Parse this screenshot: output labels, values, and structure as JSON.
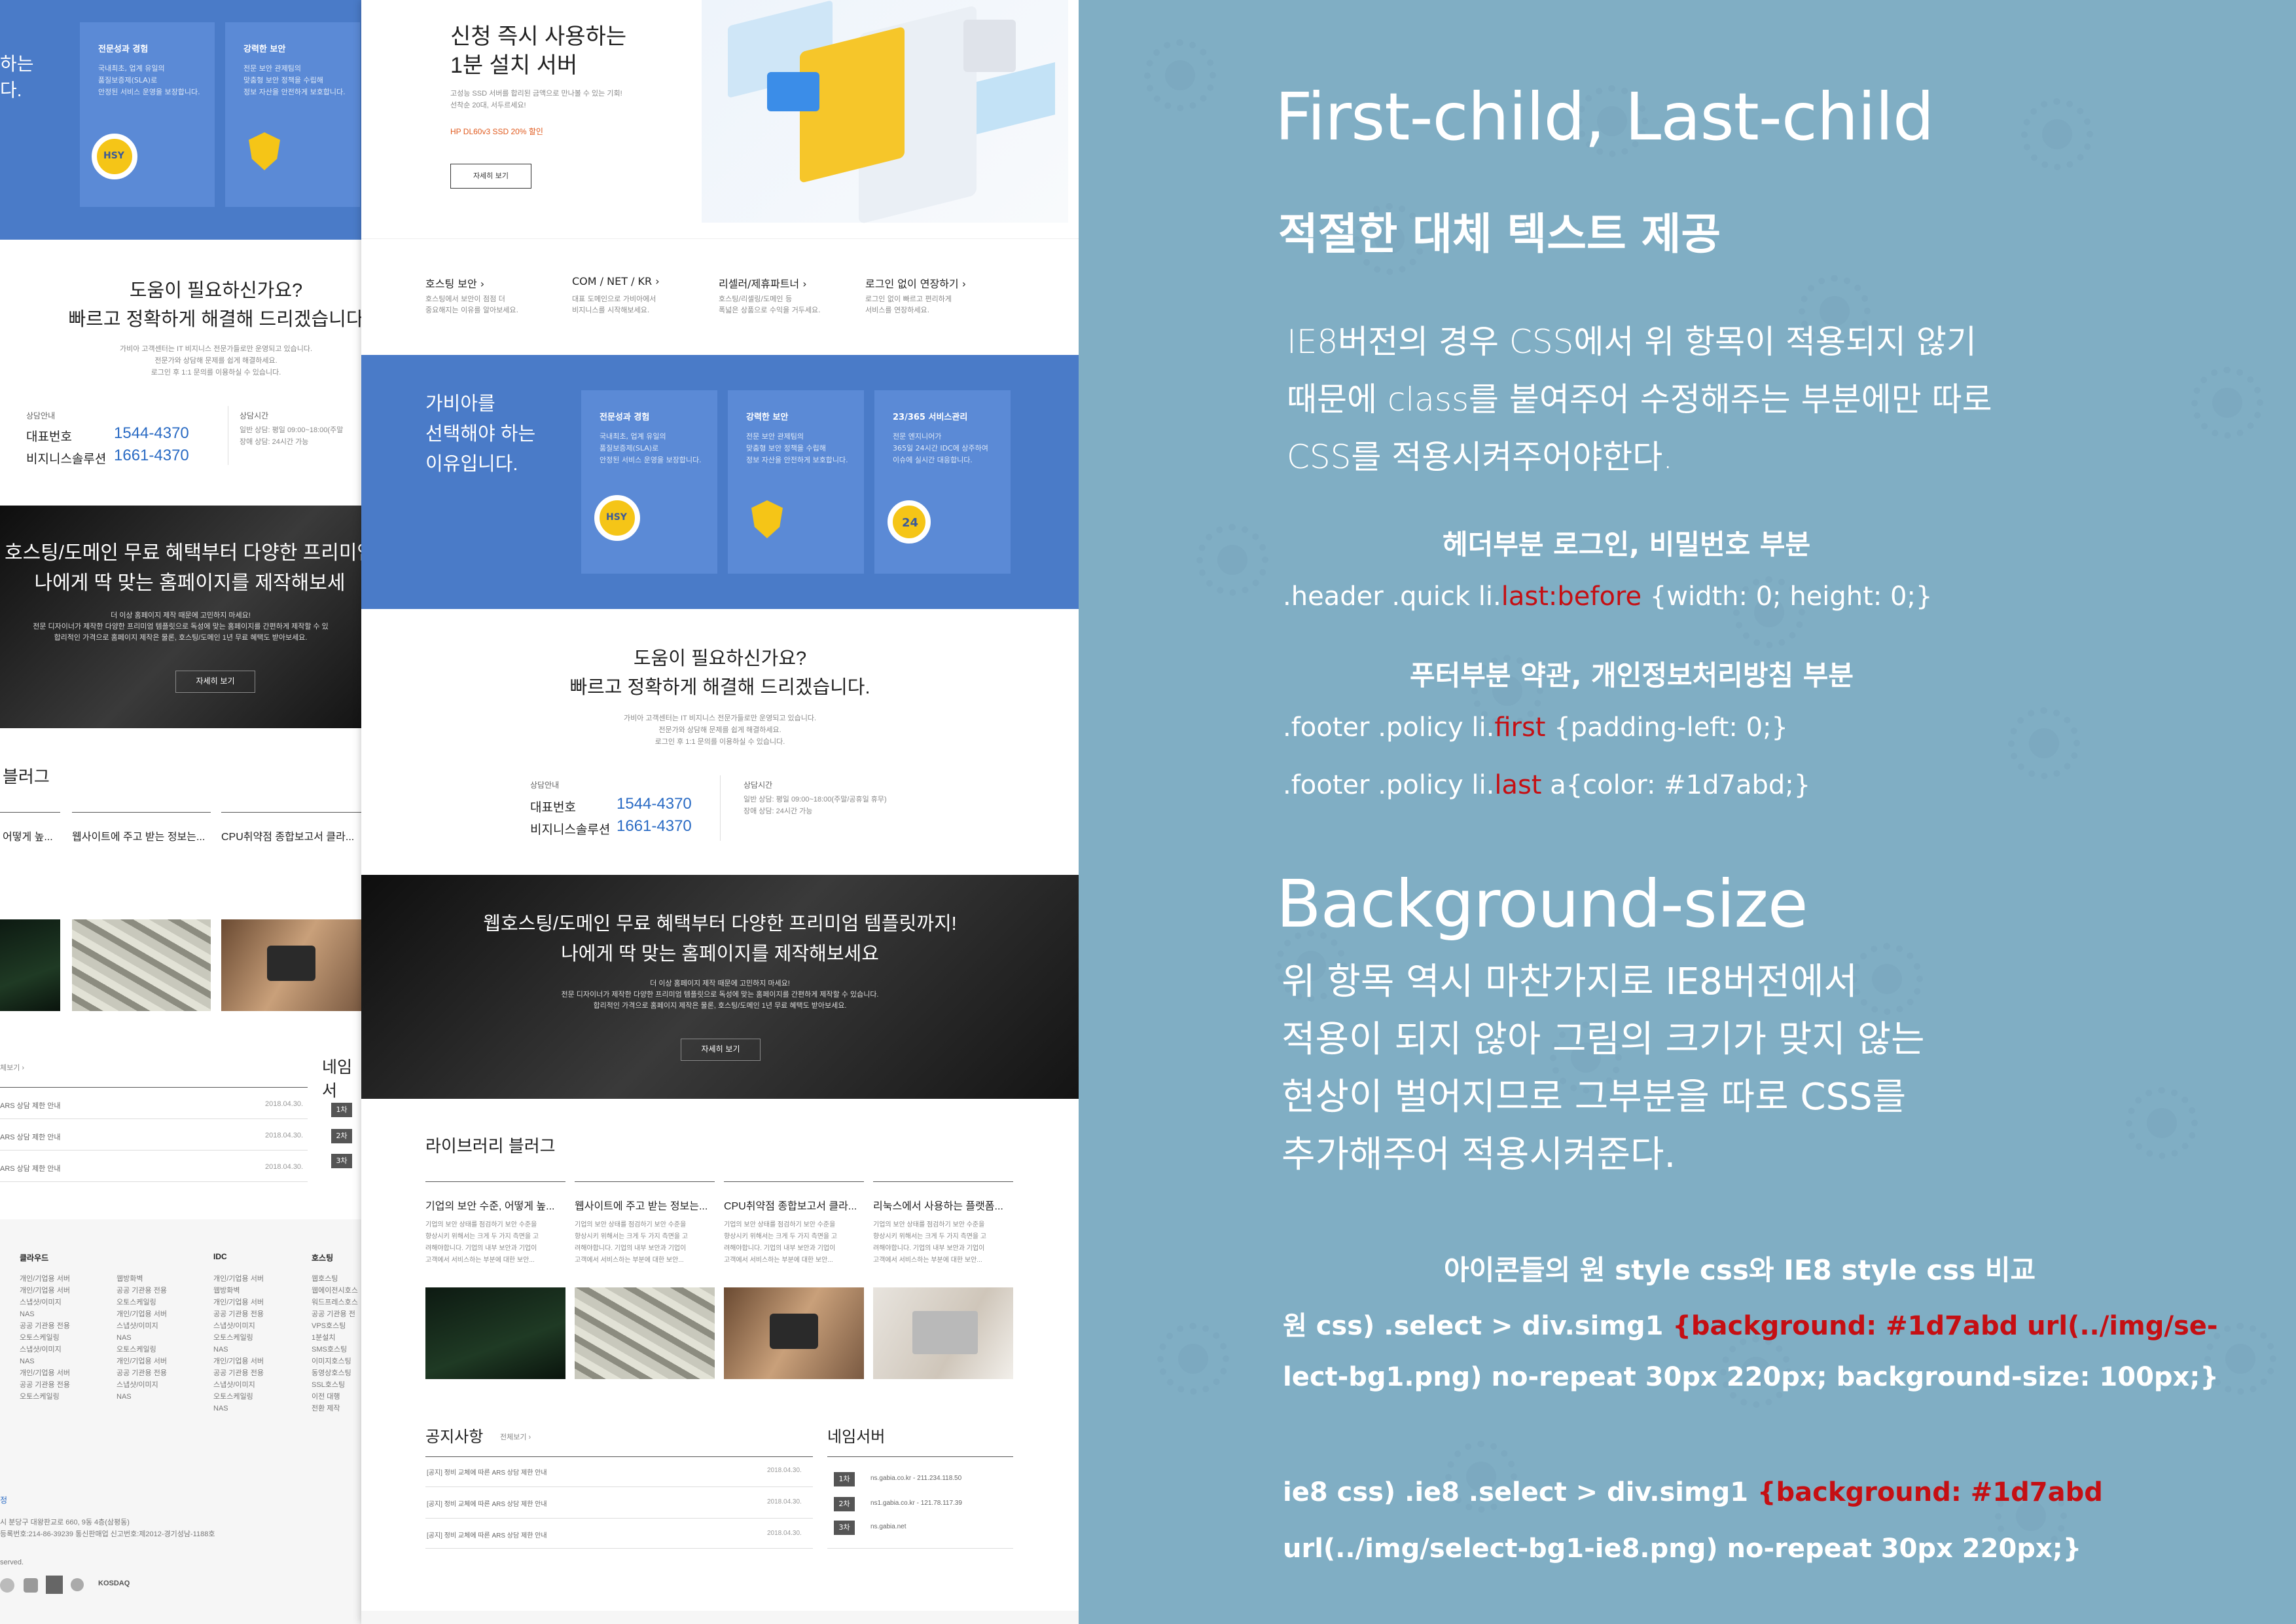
{
  "notes": {
    "h1": "First-child, Last-child",
    "h2": "적절한 대체 텍스트 제공",
    "para1": "IE8버전의 경우 CSS에서 위 항목이 적용되지 않기\n때문에 class를 붙여주어 수정해주는 부분에만 따로\nCSS를 적용시켜주어야한다.",
    "sub1": "헤더부분 로그인, 비밀번호 부분",
    "code1a": ".header .quick li.",
    "code1b": "last:before",
    "code1c": " {width: 0; height: 0;}",
    "sub2": "푸터부분 약관, 개인정보처리방침 부분",
    "code2a": ".footer .policy li.",
    "code2b": "first",
    "code2c": " {padding-left: 0;}",
    "code3a": ".footer .policy li.",
    "code3b": "last",
    "code3c": " a{color: #1d7abd;}",
    "h1b": "Background-size",
    "para2": "위 항목 역시 마찬가지로 IE8버전에서\n적용이 되지 않아 그림의 크기가 맞지 않는\n현상이 벌어지므로 그부분을 따로 CSS를\n추가해주어 적용시켜준다.",
    "sub3": "아이콘들의 원 style css와 IE8 style css 비교",
    "orig_label": "원 css) .select > div.simg1 ",
    "orig_red1": "{background: #1d7abd url(../img/se-",
    "orig_red2": "lect-bg1.png) no-repeat 30px 220px; background-size: 100px;}",
    "ie8_label": "ie8 css) .ie8 .select > div.simg1 ",
    "ie8_red1": "{background: #1d7abd",
    "ie8_red2": "url(../img/select-bg1-ie8.png) no-repeat 30px 220px;}"
  },
  "page": {
    "hero_title": "신청 즉시 사용하는\n1분 설치 서버",
    "hero_desc": "고성능 SSD 서버를 합리된 금액으로 만나볼 수 있는 기회!\n선착순 20대, 서두르세요!",
    "hero_promo": "HP DL60v3 SSD 20% 할인",
    "hero_btn": "자세히 보기",
    "nav": [
      {
        "title": "호스팅 보안 ›",
        "desc": "호스팅에서 보안이 점점 더\n중요해지는 이유를 알아보세요."
      },
      {
        "title": "COM / NET / KR ›",
        "desc": "대표 도메인으로 가비아에서\n비지니스를 시작해보세요."
      },
      {
        "title": "리셀러/제휴파트너 ›",
        "desc": "호스팅/리셀링/도메인 등\n폭넓은 상품으로 수익을 거두세요."
      },
      {
        "title": "로그인 없이 연장하기 ›",
        "desc": "로그인 없이 빠르고 편리하게\n서비스를 연장하세요."
      }
    ],
    "why_title": "가비아를\n선택해야 하는\n이유입니다.",
    "cards": [
      {
        "title": "전문성과 경험",
        "desc": "국내최초, 업계 유일의\n품질보증제(SLA)로\n안정된 서비스 운영을 보장합니다."
      },
      {
        "title": "강력한 보안",
        "desc": "전문 보안 관제팀의\n맞춤형 보안 정책을 수립해\n정보 자산을 안전하게 보호합니다."
      },
      {
        "title": "23/365 서비스관리",
        "desc": "전문 엔지니어가\n365일 24시간 IDC에 상주하여\n이슈에 실시간 대응합니다."
      }
    ],
    "help_title": "도움이 필요하신가요?\n빠르고 정확하게 해결해 드리겠습니다.",
    "help_desc": "가비아 고객센터는 IT 비지니스 전문가들로만 운영되고 있습니다.\n전문가와 상담해 문제를 쉽게 해결하세요.\n로그인 후 1:1 문의를 이용하실 수 있습니다.",
    "consult_label": "상담안내",
    "rep_label": "대표번호",
    "rep_phone": "1544-4370",
    "biz_label": "비지니스솔루션",
    "biz_phone": "1661-4370",
    "hours_label": "상담시간",
    "hours_desc": "일반 상담: 평일 09:00~18:00(주말/공휴일 휴무)\n장애 상담: 24시간 가능",
    "promo_title": "웹호스팅/도메인 무료 혜택부터 다양한 프리미엄 템플릿까지!\n나에게 딱 맞는 홈페이지를 제작해보세요",
    "promo_desc": "더 이상 홈페이지 제작 때문에 고민하지 마세요!\n전문 디자이너가 제작한 다양한 프리미엄 템플릿으로 독성에 맞는 홈페이지를 간편하게 제작할 수 있습니다.\n합리적인 가격으로 홈페이지 제작은 물론, 호스팅/도메인 1년 무료 혜택도 받아보세요.",
    "promo_btn": "자세히 보기",
    "blog_title": "라이브러리 블러그",
    "posts": [
      {
        "title": "기업의 보안 수준, 어떻게 높...",
        "desc": "기업의 보안 상태를 점검하기 보안 수준을\n향상시키 위해서는 크게 두 가지 측면을 고\n려해야합니다. 기업의 내부 보안과 기업이\n고객에서 서비스하는 부분에 대한 보안..."
      },
      {
        "title": "웹사이트에 주고 받는 정보는...",
        "desc": "기업의 보안 상태를 점검하기 보안 수준을\n향상시키 위해서는 크게 두 가지 측면을 고\n려해야합니다. 기업의 내부 보안과 기업이\n고객에서 서비스하는 부분에 대한 보안..."
      },
      {
        "title": "CPU취약점 종합보고서 클라...",
        "desc": "기업의 보안 상태를 점검하기 보안 수준을\n향상시키 위해서는 크게 두 가지 측면을 고\n려해야합니다. 기업의 내부 보안과 기업이\n고객에서 서비스하는 부분에 대한 보안..."
      },
      {
        "title": "리눅스에서 사용하는 플랫폼...",
        "desc": "기업의 보안 상태를 점검하기 보안 수준을\n향상시키 위해서는 크게 두 가지 측면을 고\n려해야합니다. 기업의 내부 보안과 기업이\n고객에서 서비스하는 부분에 대한 보안..."
      }
    ],
    "notice_title": "공지사항",
    "notice_more": "전체보기 ›",
    "notices": [
      {
        "text": "[공지] 정비 교체에 따른 ARS 상담 제한 안내",
        "date": "2018.04.30."
      },
      {
        "text": "[공지] 정비 교체에 따른 ARS 상담 제한 안내",
        "date": "2018.04.30."
      },
      {
        "text": "[공지] 정비 교체에 따른 ARS 상담 제한 안내",
        "date": "2018.04.30."
      }
    ],
    "ns_title": "네임서버",
    "ns": [
      {
        "rank": "1차",
        "text": "ns.gabia.co.kr - 211.234.118.50"
      },
      {
        "rank": "2차",
        "text": "ns1.gabia.co.kr - 121.78.117.39"
      },
      {
        "rank": "3차",
        "text": "ns.gabia.net"
      }
    ]
  },
  "left": {
    "hero_tail": "하는\n다.",
    "card1_title": "전문성과 경험",
    "card1_desc": "국내최초, 업계 유일의\n품질보증제(SLA)로\n안정된 서비스 운영을 보장합니다.",
    "card2_title": "강력한 보안",
    "card2_desc": "전문 보안 관제팀의\n맞춤형 보안 정책을 수립해\n정보 자산을 안전하게 보호합니다.",
    "help_title": "도움이 필요하신가요?\n빠르고 정확하게 해결해 드리겠습니다",
    "help_desc": "가비아 고객센터는 IT 비지니스 전문가들로만 운영되고 있습니다.\n전문가와 상담해 문제를 쉽게 해결하세요.\n로그인 후 1:1 문의를 이용하실 수 있습니다.",
    "consult_label": "상담안내",
    "rep_label": "대표번호",
    "rep_phone": "1544-4370",
    "biz_label": "비지니스솔루션",
    "biz_phone": "1661-4370",
    "hours_label": "상담시간",
    "hours_desc": "일반 상담: 평일 09:00~18:00(주말\n장애 상담: 24시간 가능",
    "promo_title": "호스팅/도메인 무료 혜택부터 다양한 프리미엄\n나에게 딱 맞는 홈페이지를 제작해보세",
    "promo_desc": "더 이상 홈페이지 제작 때문에 고민하지 마세요!\n전문 디자이너가 제작한 다양한 프리미엄 템플릿으로 독성에 맞는 홈페이지를 간편하게 제작할 수 있\n합리적인 가격으로 홈페이지 제작은 물론, 호스팅/도메인 1년 무료 혜택도 받아보세요.",
    "promo_btn": "자세히 보기",
    "blog_title": "블러그",
    "post_titles": [
      "어떻게 높...",
      "웹사이트에 주고 받는 정보는...",
      "CPU취약점 종합보고서 클라..."
    ],
    "notice_more": "체보기 ›",
    "notices": [
      "ARS 상담 제한 안내",
      "ARS 상담 제한 안내",
      "ARS 상담 제한 안내"
    ],
    "dates": [
      "2018.04.30.",
      "2018.04.30.",
      "2018.04.30."
    ],
    "ns_title": "네임서",
    "ranks": [
      "1차",
      "2차",
      "3차"
    ],
    "footer_cols": [
      {
        "title": "클라우드",
        "items": "개인/기업용 서버\n개인/기업용 서버\n스냅샷/이미지\nNAS\n공공 기관용 전용\n오토스케일링\n스냅샷/이미지\nNAS\n개인/기업용 서버\n공공 기관용 전용\n오토스케일링"
      },
      {
        "title": "",
        "items": "웹방화벽\n공공 기관용 전용\n오토스케일링\n개인/기업용 서버\n스냅샷/이미지\nNAS\n오토스케일링\n개인/기업용 서버\n공공 기관용 전용\n스냅샷/이미지\nNAS"
      },
      {
        "title": "IDC",
        "items": "개인/기업용 서버\n웹방화벽\n개인/기업용 서버\n공공 기관용 전용\n스냅샷/이미지\n오토스케일링\nNAS\n개인/기업용 서버\n공공 기관용 전용\n스냅샷/이미지\n오토스케일링\nNAS"
      },
      {
        "title": "호스팅",
        "items": "웹호스팅\n웹에이전시호스\n워드프레스호스\n공공 기관용 전\nVPS호스팅\n1분설치\nSMS호스팅\n이미지호스팅\n동영상호스팅\nSSL호스팅\n이전 대행\n전환 제작"
      }
    ],
    "footer_link": "정",
    "footer_addr": "시 분당구 대왕판교로 660, 9동 4층(삼평동)\n등록번호:214-86-39239    통신판매업 신고번호:제2012-경기성남-1188호",
    "footer_copy": "served.",
    "footer_logo": "KOSDAQ"
  }
}
